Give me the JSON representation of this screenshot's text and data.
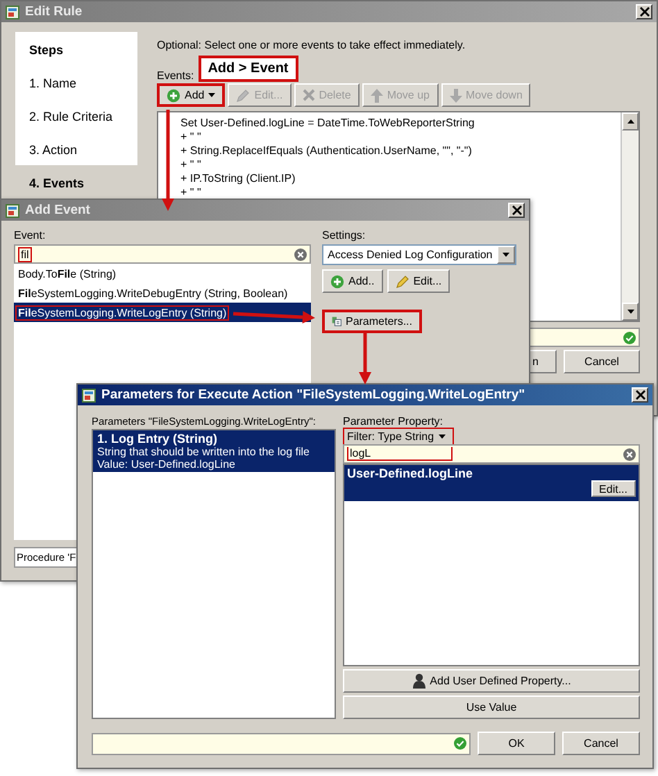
{
  "edit_rule": {
    "title": "Edit Rule",
    "steps_heading": "Steps",
    "steps": [
      {
        "label": "1. Name",
        "selected": false
      },
      {
        "label": "2. Rule Criteria",
        "selected": false
      },
      {
        "label": "3. Action",
        "selected": false
      },
      {
        "label": "4. Events",
        "selected": true
      }
    ],
    "description": "Optional: Select one or more events to take effect immediately.",
    "events_label": "Events:",
    "callout": "Add > Event",
    "toolbar": [
      {
        "label": "Add",
        "disabled": false
      },
      {
        "label": "Edit...",
        "disabled": true
      },
      {
        "label": "Delete",
        "disabled": true
      },
      {
        "label": "Move up",
        "disabled": true
      },
      {
        "label": "Move down",
        "disabled": true
      }
    ],
    "event_lines": [
      "Set User-Defined.logLine = DateTime.ToWebReporterString",
      "+ \" \"",
      "+ String.ReplaceIfEquals (Authentication.UserName, \"\", \"-\")",
      "+ \" \"",
      "+ IP.ToString (Client.IP)",
      "+ \" \""
    ],
    "footer_buttons": [
      "n",
      "Cancel"
    ]
  },
  "add_event": {
    "title": "Add Event",
    "event_label": "Event:",
    "search": "fil",
    "results": [
      {
        "text": "Body.To**Fil**e (String)",
        "selected": false
      },
      {
        "text": "**Fil**eSystemLogging.WriteDebugEntry (String, Boolean)",
        "selected": false
      },
      {
        "text": "**Fil**eSystemLogging.WriteLogEntry (String)",
        "selected": true
      }
    ],
    "procedure": "Procedure 'F",
    "settings_label": "Settings:",
    "settings_value": "Access Denied Log Configuration",
    "settings_buttons": [
      "Add..",
      "Edit..."
    ],
    "parameters_button": "Parameters..."
  },
  "parameters": {
    "title": "Parameters for Execute Action \"FileSystemLogging.WriteLogEntry\"",
    "list_label": "Parameters \"FileSystemLogging.WriteLogEntry\":",
    "items": [
      {
        "name": "1. Log Entry (String)",
        "description": "String that should be written into the log file",
        "value": "Value: User-Defined.logLine",
        "selected": true
      }
    ],
    "property_label": "Parameter Property:",
    "filter": "Filter: Type String",
    "search": "logL",
    "properties": [
      {
        "name": "User-Defined.logLine",
        "edit": "Edit...",
        "selected": true
      }
    ],
    "add_property": "Add User Defined Property...",
    "use_value": "Use Value",
    "buttons": [
      "OK",
      "Cancel"
    ]
  }
}
